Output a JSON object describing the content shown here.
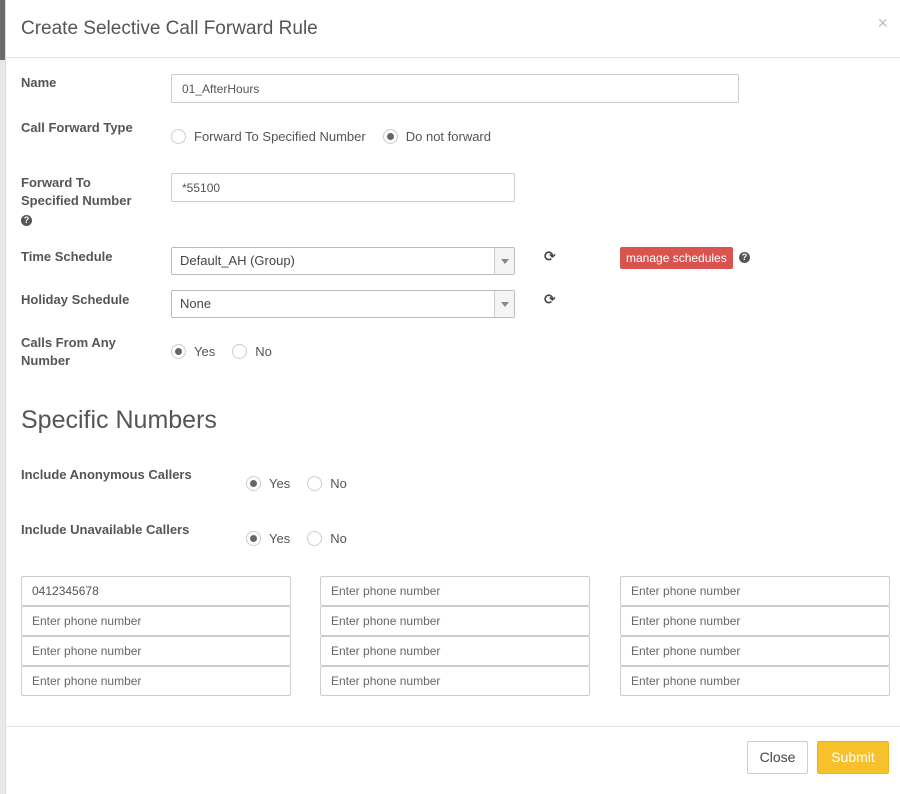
{
  "modal": {
    "title": "Create Selective Call Forward Rule",
    "close_glyph": "×"
  },
  "form": {
    "name": {
      "label": "Name",
      "value": "01_AfterHours"
    },
    "call_forward_type": {
      "label": "Call Forward Type",
      "options": [
        "Forward To Specified Number",
        "Do not forward"
      ],
      "selected": "Do not forward"
    },
    "forward_to": {
      "label_line1": "Forward To",
      "label_line2": "Specified Number",
      "value": "*55100"
    },
    "time_schedule": {
      "label": "Time Schedule",
      "value": "Default_AH (Group)"
    },
    "manage_schedules_label": "manage schedules",
    "holiday_schedule": {
      "label": "Holiday Schedule",
      "value": "None"
    },
    "calls_from_any": {
      "label_line1": "Calls From Any",
      "label_line2": "Number",
      "options": [
        "Yes",
        "No"
      ],
      "selected": "Yes"
    }
  },
  "specific_numbers": {
    "title": "Specific Numbers",
    "include_anonymous": {
      "label": "Include Anonymous Callers",
      "options": [
        "Yes",
        "No"
      ],
      "selected": "Yes"
    },
    "include_unavailable": {
      "label": "Include Unavailable Callers",
      "options": [
        "Yes",
        "No"
      ],
      "selected": "Yes"
    },
    "placeholder": "Enter phone number",
    "phones": [
      "0412345678",
      "",
      "",
      "",
      "",
      "",
      "",
      "",
      "",
      "",
      "",
      ""
    ]
  },
  "footer": {
    "close_label": "Close",
    "submit_label": "Submit"
  },
  "colors": {
    "danger": "#d9534f",
    "warning": "#f8c12c",
    "accent": "#3a9ad9"
  },
  "icons": {
    "refresh": "refresh-icon",
    "help": "question-circle-icon",
    "close": "close-icon",
    "dropdown": "chevron-down-icon"
  }
}
